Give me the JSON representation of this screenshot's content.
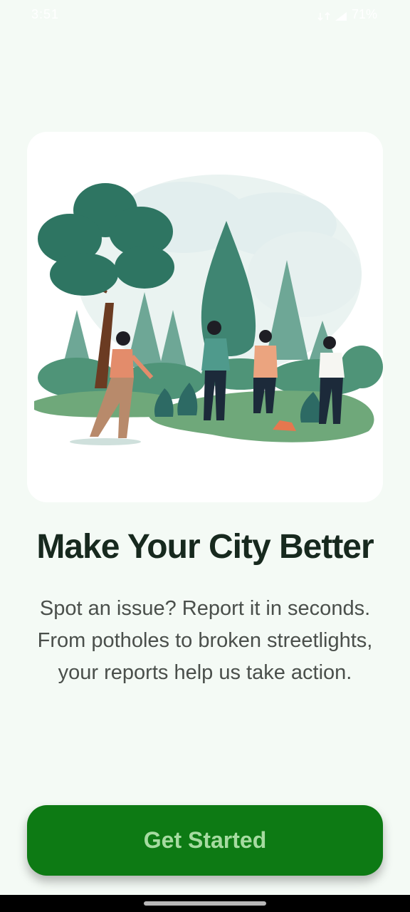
{
  "status_bar": {
    "time": "3:51",
    "icons": [
      "data-icon",
      "sound-icon",
      "signal-icon",
      "battery-icon"
    ],
    "battery_text": "71%"
  },
  "onboarding": {
    "illustration": "park-cleanup-illustration",
    "title": "Make Your City Better",
    "description": "Spot an issue? Report it in seconds. From potholes to broken streetlights, your reports help us take action.",
    "cta_label": "Get Started"
  },
  "colors": {
    "background": "#f4faf5",
    "button": "#0d7a14",
    "button_text": "#a6dba1",
    "title": "#17291e",
    "body_text": "#4a4f4b"
  }
}
